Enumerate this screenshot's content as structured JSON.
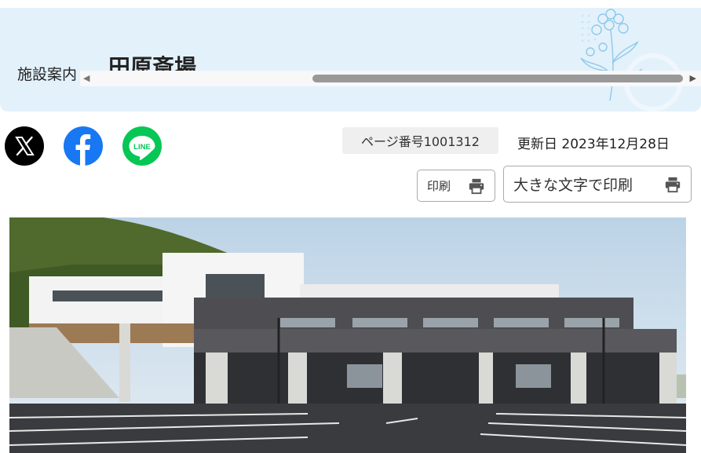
{
  "banner": {
    "category": "施設案内",
    "title": "田原斎場"
  },
  "social": [
    {
      "name": "X",
      "icon": "x-logo-icon"
    },
    {
      "name": "Facebook",
      "icon": "facebook-icon"
    },
    {
      "name": "LINE",
      "icon": "line-icon",
      "label": "LINE"
    }
  ],
  "meta": {
    "page_number": "ページ番号1001312",
    "updated": "更新日 2023年12月28日"
  },
  "print": {
    "print_label": "印刷",
    "large_print_label": "大きな文字で印刷",
    "icon": "printer-icon"
  },
  "colors": {
    "banner_bg": "#e3f1fb",
    "facebook": "#1877f2",
    "line": "#06c755",
    "x": "#000000"
  }
}
